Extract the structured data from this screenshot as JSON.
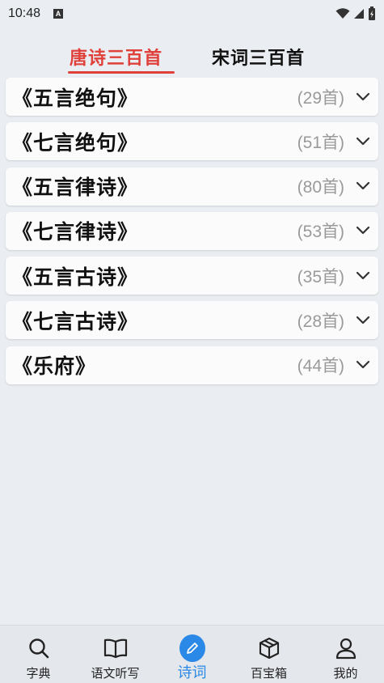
{
  "status_bar": {
    "time": "10:48",
    "notification_icon": "A"
  },
  "tabs": [
    {
      "label": "唐诗三百首",
      "active": true
    },
    {
      "label": "宋词三百首",
      "active": false
    }
  ],
  "accent_color": "#e0403a",
  "nav_active_color": "#2a88e6",
  "poem_categories": [
    {
      "title": "《五言绝句》",
      "count": "(29首)"
    },
    {
      "title": "《七言绝句》",
      "count": "(51首)"
    },
    {
      "title": "《五言律诗》",
      "count": "(80首)"
    },
    {
      "title": "《七言律诗》",
      "count": "(53首)"
    },
    {
      "title": "《五言古诗》",
      "count": "(35首)"
    },
    {
      "title": "《七言古诗》",
      "count": "(28首)"
    },
    {
      "title": "《乐府》",
      "count": "(44首)"
    }
  ],
  "bottom_nav": [
    {
      "label": "字典",
      "icon": "search-icon"
    },
    {
      "label": "语文听写",
      "icon": "book-icon"
    },
    {
      "label": "诗词",
      "icon": "pen-icon",
      "active": true
    },
    {
      "label": "百宝箱",
      "icon": "box-icon"
    },
    {
      "label": "我的",
      "icon": "user-icon"
    }
  ]
}
